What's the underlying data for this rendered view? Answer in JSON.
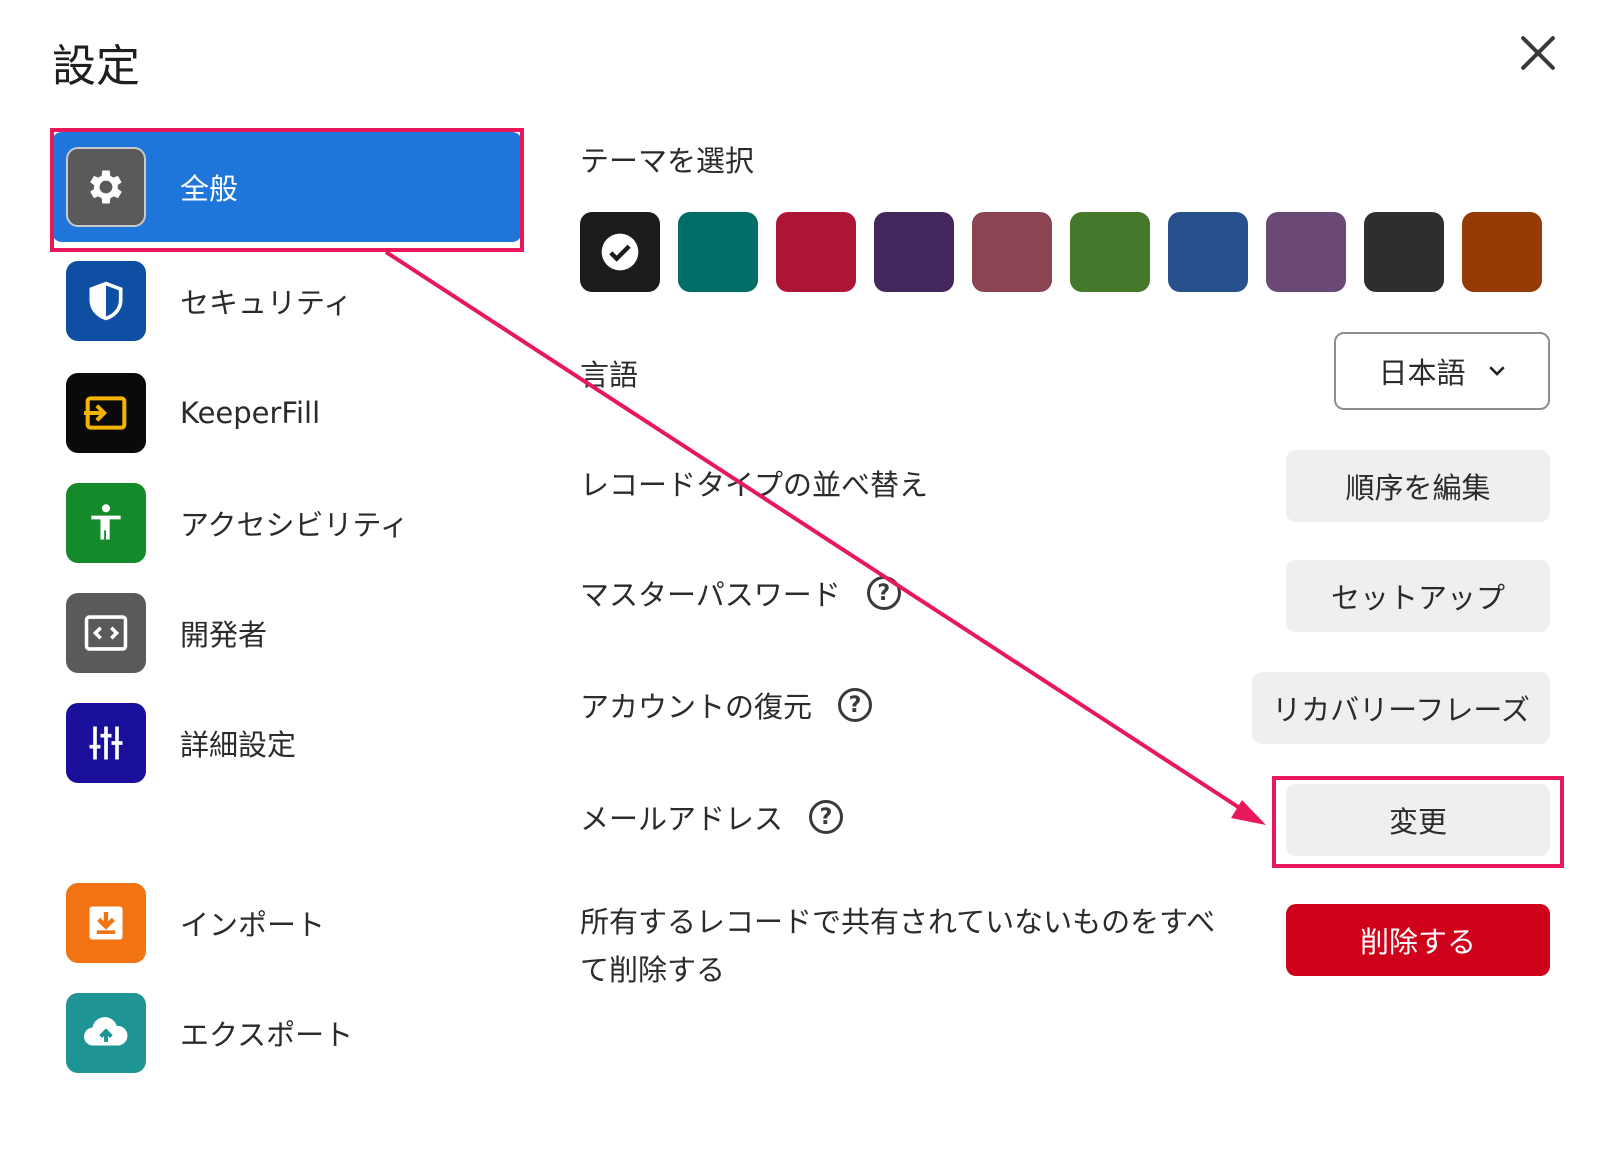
{
  "title": "設定",
  "sidebar": {
    "items": [
      {
        "label": "全般",
        "icon": "gear-icon",
        "color": "#5a5a5a",
        "active": true
      },
      {
        "label": "セキュリティ",
        "icon": "shield-icon",
        "color": "#0f4fa3"
      },
      {
        "label": "KeeperFill",
        "icon": "keeperfill-icon",
        "color": "#0a0a0a"
      },
      {
        "label": "アクセシビリティ",
        "icon": "accessibility-icon",
        "color": "#148a2a"
      },
      {
        "label": "開発者",
        "icon": "code-icon",
        "color": "#5a5a5a"
      },
      {
        "label": "詳細設定",
        "icon": "sliders-icon",
        "color": "#1a0f9a"
      },
      {
        "label": "インポート",
        "icon": "import-icon",
        "color": "#f27312"
      },
      {
        "label": "エクスポート",
        "icon": "cloud-upload-icon",
        "color": "#1f9494"
      }
    ]
  },
  "settings": {
    "theme_label": "テーマを選択",
    "theme_colors": [
      "#1c1c1c",
      "#006e66",
      "#ad1436",
      "#44275c",
      "#8a4452",
      "#44782a",
      "#28508f",
      "#6a4a74",
      "#2e2e2e",
      "#963a06"
    ],
    "language_label": "言語",
    "language_value": "日本語",
    "record_sort_label": "レコードタイプの並べ替え",
    "record_sort_button": "順序を編集",
    "master_password_label": "マスターパスワード",
    "master_password_button": "セットアップ",
    "account_recovery_label": "アカウントの復元",
    "account_recovery_button": "リカバリーフレーズ",
    "email_label": "メールアドレス",
    "email_button": "変更",
    "delete_label": "所有するレコードで共有されていないものをすべて削除する",
    "delete_button": "削除する",
    "help_glyph": "?"
  },
  "accent_color": "#e8185a"
}
